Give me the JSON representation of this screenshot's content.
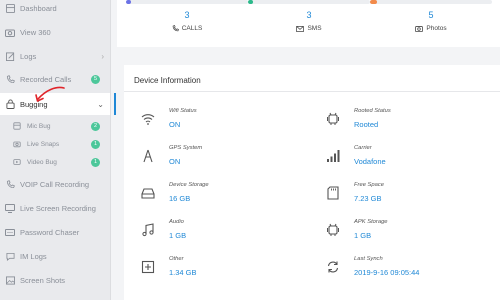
{
  "sidebar": {
    "items": [
      {
        "label": "Dashboard",
        "icon": "dashboard-icon"
      },
      {
        "label": "View 360",
        "icon": "camera-icon"
      },
      {
        "label": "Logs",
        "icon": "pencil-icon"
      },
      {
        "label": "Recorded Calls",
        "icon": "phone-icon",
        "badge": "5"
      },
      {
        "label": "Bugging",
        "icon": "lock-icon"
      },
      {
        "label": "Mic Bug",
        "icon": "mic-icon",
        "badge": "2"
      },
      {
        "label": "Live Snaps",
        "icon": "camera-icon",
        "badge": "1"
      },
      {
        "label": "Video Bug",
        "icon": "video-icon",
        "badge": "1"
      },
      {
        "label": "VOIP Call Recording",
        "icon": "phone-icon"
      },
      {
        "label": "Live Screen Recording",
        "icon": "screen-icon"
      },
      {
        "label": "Password Chaser",
        "icon": "key-icon"
      },
      {
        "label": "IM Logs",
        "icon": "chat-icon"
      },
      {
        "label": "Screen Shots",
        "icon": "image-icon"
      }
    ]
  },
  "stats": [
    {
      "value": "3",
      "label": "CALLS",
      "icon": "phone-icon",
      "color": "#6b72e6",
      "fill": 0.04
    },
    {
      "value": "3",
      "label": "SMS",
      "icon": "mail-icon",
      "color": "#2bb98a",
      "fill": 0.04
    },
    {
      "value": "5",
      "label": "Photos",
      "icon": "camera-icon",
      "color": "#f28a4a",
      "fill": 0.06
    }
  ],
  "device": {
    "title": "Device Information",
    "fields": [
      {
        "key": "Wifi Status",
        "value": "ON",
        "icon": "wifi-icon"
      },
      {
        "key": "Rooted Status",
        "value": "Rooted",
        "icon": "android-icon"
      },
      {
        "key": "GPS System",
        "value": "ON",
        "icon": "gps-icon"
      },
      {
        "key": "Carrier",
        "value": "Vodafone",
        "icon": "signal-icon"
      },
      {
        "key": "Device Storage",
        "value": "16 GB",
        "icon": "storage-icon"
      },
      {
        "key": "Free Space",
        "value": "7.23 GB",
        "icon": "sdcard-icon"
      },
      {
        "key": "Audio",
        "value": "1 GB",
        "icon": "music-icon"
      },
      {
        "key": "APK Storage",
        "value": "1 GB",
        "icon": "android-icon"
      },
      {
        "key": "Other",
        "value": "1.34 GB",
        "icon": "plus-box-icon"
      },
      {
        "key": "Last Synch",
        "value": "2019-9-16 09:05:44",
        "icon": "sync-icon"
      }
    ]
  },
  "colors": {
    "accent": "#1f88d6",
    "badge": "#4cc79a",
    "annotation": "#e0242a"
  }
}
